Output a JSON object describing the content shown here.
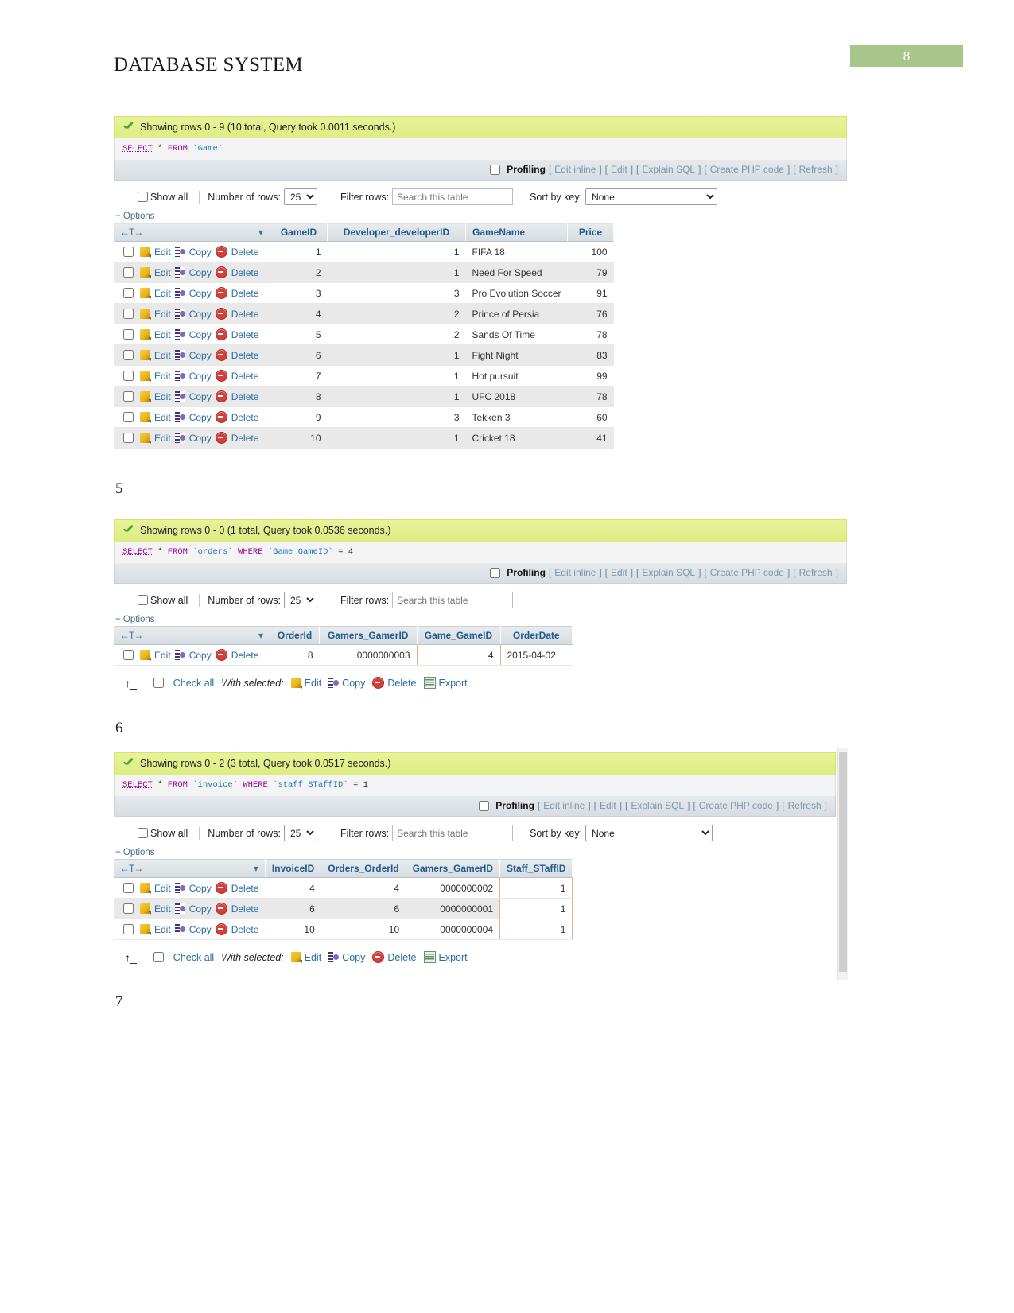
{
  "document": {
    "title": "DATABASE SYSTEM",
    "page_number": "8"
  },
  "steps": {
    "step5": "5",
    "step6": "6",
    "step7": "7"
  },
  "common": {
    "show_all": "Show all",
    "number_of_rows": "Number of rows:",
    "rows_value": "25",
    "filter_rows": "Filter rows:",
    "filter_placeholder": "Search this table",
    "sort_by_key": "Sort by key:",
    "sort_value": "None",
    "options": "+ Options",
    "profiling": "Profiling",
    "edit_inline": "Edit inline",
    "edit": "Edit",
    "explain_sql": "Explain SQL",
    "create_php": "Create PHP code",
    "refresh": "Refresh",
    "action_edit": "Edit",
    "action_copy": "Copy",
    "action_delete": "Delete",
    "check_all": "Check all",
    "with_selected": "With selected:",
    "export": "Export",
    "icons": {
      "check": "check-icon",
      "pencil": "pencil-icon",
      "copy": "copy-icon",
      "delete": "delete-circle-icon",
      "export": "export-icon",
      "sort": "chevron-down-icon",
      "move": "move-columns-icon",
      "arrow_up": "arrow-up-icon"
    }
  },
  "panels": [
    {
      "id": "game",
      "notice": "Showing rows 0 - 9 (10 total, Query took 0.0011 seconds.)",
      "sql": {
        "select": "SELECT",
        "star": "*",
        "from": "FROM",
        "table": "`Game`"
      },
      "has_sort_key": true,
      "columns": [
        "GameID",
        "Developer_developerID",
        "GameName",
        "Price"
      ],
      "rows": [
        {
          "GameID": "1",
          "Developer_developerID": "1",
          "GameName": "FIFA 18",
          "Price": "100"
        },
        {
          "GameID": "2",
          "Developer_developerID": "1",
          "GameName": "Need For Speed",
          "Price": "79"
        },
        {
          "GameID": "3",
          "Developer_developerID": "3",
          "GameName": "Pro Evolution Soccer",
          "Price": "91"
        },
        {
          "GameID": "4",
          "Developer_developerID": "2",
          "GameName": "Prince of Persia",
          "Price": "76"
        },
        {
          "GameID": "5",
          "Developer_developerID": "2",
          "GameName": "Sands Of Time",
          "Price": "78"
        },
        {
          "GameID": "6",
          "Developer_developerID": "1",
          "GameName": "Fight Night",
          "Price": "83"
        },
        {
          "GameID": "7",
          "Developer_developerID": "1",
          "GameName": "Hot pursuit",
          "Price": "99"
        },
        {
          "GameID": "8",
          "Developer_developerID": "1",
          "GameName": "UFC 2018",
          "Price": "78"
        },
        {
          "GameID": "9",
          "Developer_developerID": "3",
          "GameName": "Tekken 3",
          "Price": "60"
        },
        {
          "GameID": "10",
          "Developer_developerID": "1",
          "GameName": "Cricket 18",
          "Price": "41"
        }
      ]
    },
    {
      "id": "orders",
      "notice": "Showing rows 0 - 0 (1 total, Query took 0.0536 seconds.)",
      "sql": {
        "select": "SELECT",
        "star": "*",
        "from": "FROM",
        "table": "`orders`",
        "where": "WHERE",
        "column": "`Game_GameID`",
        "op": "=",
        "value": "4"
      },
      "has_sort_key": false,
      "columns": [
        "OrderId",
        "Gamers_GamerID",
        "Game_GameID",
        "OrderDate"
      ],
      "rows": [
        {
          "OrderId": "8",
          "Gamers_GamerID": "0000000003",
          "Game_GameID": "4",
          "OrderDate": "2015-04-02"
        }
      ]
    },
    {
      "id": "invoice",
      "notice": "Showing rows 0 - 2 (3 total, Query took 0.0517 seconds.)",
      "sql": {
        "select": "SELECT",
        "star": "*",
        "from": "FROM",
        "table": "`invoice`",
        "where": "WHERE",
        "column": "`staff_STaffID`",
        "op": "=",
        "value": "1"
      },
      "has_sort_key": true,
      "columns": [
        "InvoiceID",
        "Orders_OrderId",
        "Gamers_GamerID",
        "Staff_STaffID"
      ],
      "rows": [
        {
          "InvoiceID": "4",
          "Orders_OrderId": "4",
          "Gamers_GamerID": "0000000002",
          "Staff_STaffID": "1"
        },
        {
          "InvoiceID": "6",
          "Orders_OrderId": "6",
          "Gamers_GamerID": "0000000001",
          "Staff_STaffID": "1"
        },
        {
          "InvoiceID": "10",
          "Orders_OrderId": "10",
          "Gamers_GamerID": "0000000004",
          "Staff_STaffID": "1"
        }
      ]
    }
  ],
  "colors": {
    "notice_bg": "#e3f08f",
    "page_badge": "#a9c68a",
    "header_text": "#235a8c",
    "link": "#2b6ca3"
  }
}
